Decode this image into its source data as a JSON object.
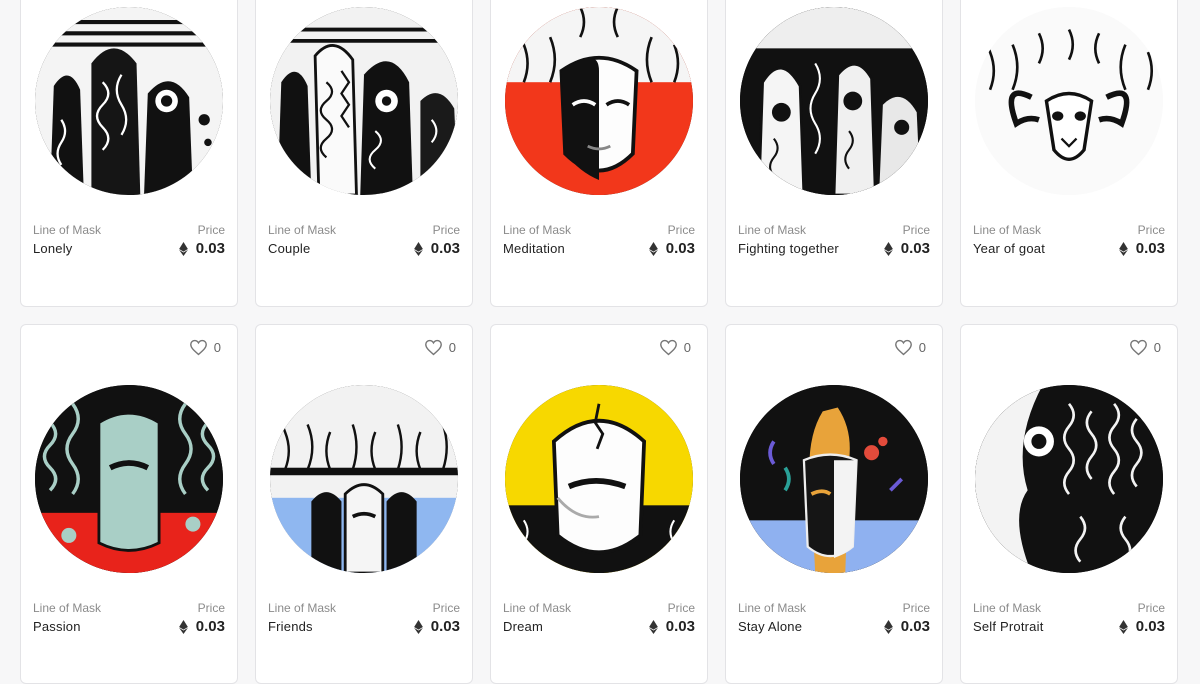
{
  "colors": {
    "background": "#f7f7f8",
    "card": "#ffffff",
    "card_border": "#e3e3e6",
    "muted_text": "#8b8b8b",
    "text": "#222222"
  },
  "price_label": "Price",
  "cards": [
    {
      "collection": "Line of Mask",
      "title": "Lonely",
      "price": "0.03",
      "accent": "#ffffff"
    },
    {
      "collection": "Line of Mask",
      "title": "Couple",
      "price": "0.03",
      "accent": "#ffffff"
    },
    {
      "collection": "Line of Mask",
      "title": "Meditation",
      "price": "0.03",
      "accent": "#f2371b"
    },
    {
      "collection": "Line of Mask",
      "title": "Fighting together",
      "price": "0.03",
      "accent": "#ffffff"
    },
    {
      "collection": "Line of Mask",
      "title": "Year of goat",
      "price": "0.03",
      "accent": "#ffffff"
    },
    {
      "collection": "Line of Mask",
      "title": "Passion",
      "price": "0.03",
      "likes": "0",
      "accent": "#e8231b"
    },
    {
      "collection": "Line of Mask",
      "title": "Friends",
      "price": "0.03",
      "likes": "0",
      "accent": "#8fb7f0"
    },
    {
      "collection": "Line of Mask",
      "title": "Dream",
      "price": "0.03",
      "likes": "0",
      "accent": "#f7d800"
    },
    {
      "collection": "Line of Mask",
      "title": "Stay Alone",
      "price": "0.03",
      "likes": "0",
      "accent": "#8fb1f0"
    },
    {
      "collection": "Line of Mask",
      "title": "Self Protrait",
      "price": "0.03",
      "likes": "0",
      "accent": "#ffffff"
    }
  ]
}
